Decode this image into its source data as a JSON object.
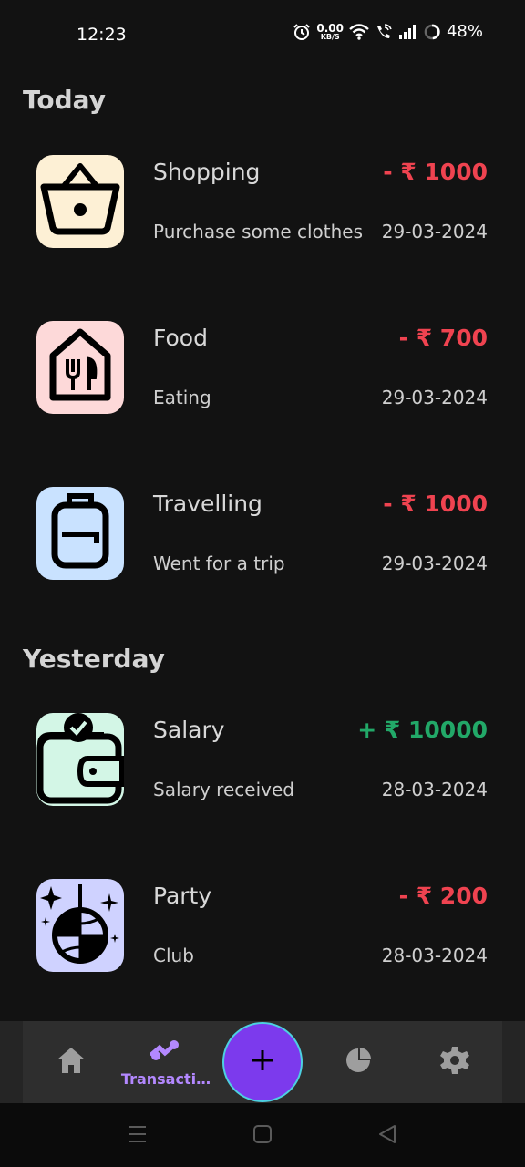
{
  "status_bar": {
    "time": "12:23",
    "net_speed_value": "0.00",
    "net_speed_unit": "KB/S",
    "battery": "48%"
  },
  "sections": {
    "today": "Today",
    "yesterday": "Yesterday"
  },
  "transactions": [
    {
      "title": "Shopping",
      "amount": "- ₹ 1000",
      "description": "Purchase some clothes",
      "date": "29-03-2024",
      "type": "expense",
      "icon": "shopping-basket-icon",
      "icon_bg": "#fdf0d5"
    },
    {
      "title": "Food",
      "amount": "- ₹ 700",
      "description": "Eating",
      "date": "29-03-2024",
      "type": "expense",
      "icon": "restaurant-icon",
      "icon_bg": "#fdd9d9"
    },
    {
      "title": "Travelling",
      "amount": "- ₹ 1000",
      "description": "Went for a trip",
      "date": "29-03-2024",
      "type": "expense",
      "icon": "backpack-icon",
      "icon_bg": "#c9e2ff"
    },
    {
      "title": "Salary",
      "amount": "+ ₹ 10000",
      "description": "Salary received",
      "date": "28-03-2024",
      "type": "income",
      "icon": "wallet-icon",
      "icon_bg": "#d3f6e6"
    },
    {
      "title": "Party",
      "amount": "- ₹ 200",
      "description": "Club",
      "date": "28-03-2024",
      "type": "expense",
      "icon": "disco-ball-icon",
      "icon_bg": "#cfd2ff"
    }
  ],
  "bottom_nav": {
    "transactions_label": "Transacti…",
    "items": [
      "home-icon",
      "transactions-icon",
      "add-icon",
      "pie-chart-icon",
      "settings-icon"
    ]
  },
  "colors": {
    "expense": "#ef4350",
    "income": "#22a868",
    "accent": "#7c3aed",
    "nav_label": "#b388ff"
  }
}
